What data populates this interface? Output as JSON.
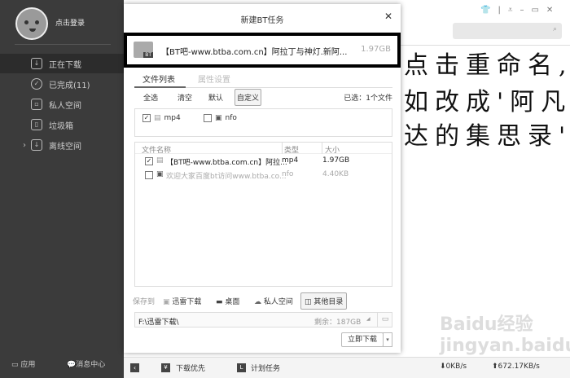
{
  "sidebar": {
    "login": "点击登录",
    "items": [
      {
        "label": "正在下载",
        "icon": "download-icon"
      },
      {
        "label": "已完成(11)",
        "icon": "check-circle-icon"
      },
      {
        "label": "私人空间",
        "icon": "lock-icon"
      },
      {
        "label": "垃圾箱",
        "icon": "trash-icon"
      },
      {
        "label": "离线空间",
        "icon": "cloud-download-icon"
      }
    ],
    "apps": "应用",
    "messages": "消息中心"
  },
  "dialog": {
    "title": "新建BT任务",
    "torrent_name": "【BT吧-www.btba.com.cn】阿拉丁与神灯.新阿...",
    "torrent_size": "1.97GB",
    "torrent_badge": "BT",
    "tabs": [
      "文件列表",
      "属性设置"
    ],
    "actions": [
      "全选",
      "清空",
      "默认",
      "自定义"
    ],
    "selected": "已选：1个文件",
    "filters": [
      {
        "label": "mp4",
        "checked": true
      },
      {
        "label": "nfo",
        "checked": false
      }
    ],
    "columns": [
      "文件名称",
      "类型",
      "大小"
    ],
    "files": [
      {
        "name": "【BT吧-www.btba.com.cn】阿拉...",
        "type": "mp4",
        "size": "1.97GB",
        "checked": true
      },
      {
        "name": "欢迎大家百度bt访问www.btba.co...",
        "type": "nfo",
        "size": "4.40KB",
        "checked": false
      }
    ],
    "save_to": "保存到",
    "locations": [
      "迅雷下载",
      "桌面",
      "私人空间",
      "其他目录"
    ],
    "path": "F:\\迅雷下载\\",
    "free": "剩余：187GB",
    "download_now": "立即下载"
  },
  "annotation": [
    "点击重命名,",
    "如改成'阿凡",
    "达的集思录'"
  ],
  "status": {
    "priority": "下载优先",
    "schedule": "计划任务",
    "down_speed": "0KB/s",
    "up_speed": "672.17KB/s"
  },
  "watermark": "Baidu经验 jingyan.baidu.com"
}
